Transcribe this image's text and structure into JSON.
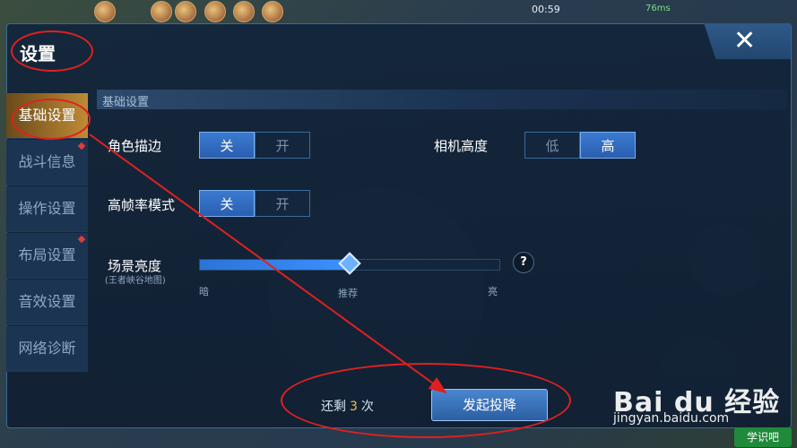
{
  "status_bar": {
    "time": "00:59",
    "signal": "76ms"
  },
  "dialog": {
    "title": "设置",
    "close_glyph": "✕",
    "sidebar": [
      {
        "label": "基础设置",
        "active": true,
        "badge": false
      },
      {
        "label": "战斗信息",
        "active": false,
        "badge": true
      },
      {
        "label": "操作设置",
        "active": false,
        "badge": false
      },
      {
        "label": "布局设置",
        "active": false,
        "badge": true
      },
      {
        "label": "音效设置",
        "active": false,
        "badge": false
      },
      {
        "label": "网络诊断",
        "active": false,
        "badge": false
      }
    ],
    "section_title": "基础设置",
    "settings": {
      "outline": {
        "label": "角色描边",
        "off": "关",
        "on": "开",
        "selected": "off"
      },
      "camera_height": {
        "label": "相机高度",
        "low": "低",
        "high": "高",
        "selected": "high"
      },
      "high_fps": {
        "label": "高帧率模式",
        "off": "关",
        "on": "开",
        "selected": "off"
      },
      "brightness": {
        "label": "场景亮度",
        "sublabel": "(王者峡谷地图)",
        "min_label": "暗",
        "mid_label": "推荐",
        "max_label": "亮",
        "value": 0.5,
        "help": "?"
      }
    },
    "footer": {
      "remain_prefix": "还剩",
      "remain_count": "3",
      "remain_suffix": "次",
      "surrender_button": "发起投降"
    }
  },
  "watermark": {
    "brand": "Bai du 经验",
    "url": "jingyan.baidu.com",
    "badge": "学识吧"
  },
  "colors": {
    "accent": "#3b7ad0",
    "annotation": "#e02020",
    "active_tab": "#c08a36"
  }
}
